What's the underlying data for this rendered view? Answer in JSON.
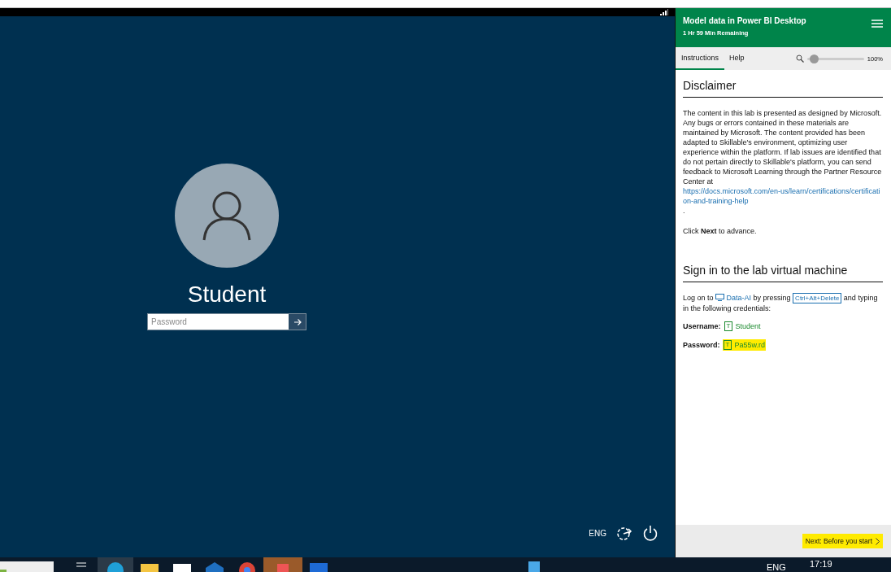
{
  "vm": {
    "user_name": "Student",
    "password_field": {
      "placeholder": "Password"
    },
    "language": "ENG"
  },
  "lab_panel": {
    "title": "Model data in Power BI Desktop",
    "time_remaining": "1 Hr 59 Min Remaining",
    "tabs": [
      {
        "label": "Instructions",
        "selected": true
      },
      {
        "label": "Help",
        "selected": false
      }
    ],
    "zoom": {
      "level": 0.12,
      "reading": "100%"
    },
    "disclaimer": {
      "heading": "Disclaimer",
      "text": "The content in this lab is presented as designed by Microsoft. Any bugs or errors contained in these materials are maintained by Microsoft. The content provided has been adapted to Skillable's environment, optimizing user experience within the platform. If lab issues are identified that do not pertain directly to Skillable's platform, you can send feedback to Microsoft Learning through the Partner Resource Center at ",
      "link": "https://docs.microsoft.com/en-us/learn/certifications/certification-and-training-help",
      "after": ".",
      "note": "Click **Next** to advance."
    },
    "sign_in": {
      "heading": "Sign in to the lab virtual machine",
      "before": "Log on to ",
      "machine": "Data-AI",
      "middle": " by pressing ",
      "key": "Ctrl+Alt+Delete",
      "after": " and typing in the following credentials:",
      "credentials": [
        {
          "label": "Username:",
          "button": "T",
          "value": "Student",
          "highlighted": false
        },
        {
          "label": "Password:",
          "button": "T",
          "value": "Pa55w.rd",
          "highlighted": true
        }
      ]
    },
    "next_button": {
      "label": "Next: Before you start",
      "highlighted": true
    }
  },
  "taskbar": {
    "language": "ENG",
    "time": "17:19"
  }
}
